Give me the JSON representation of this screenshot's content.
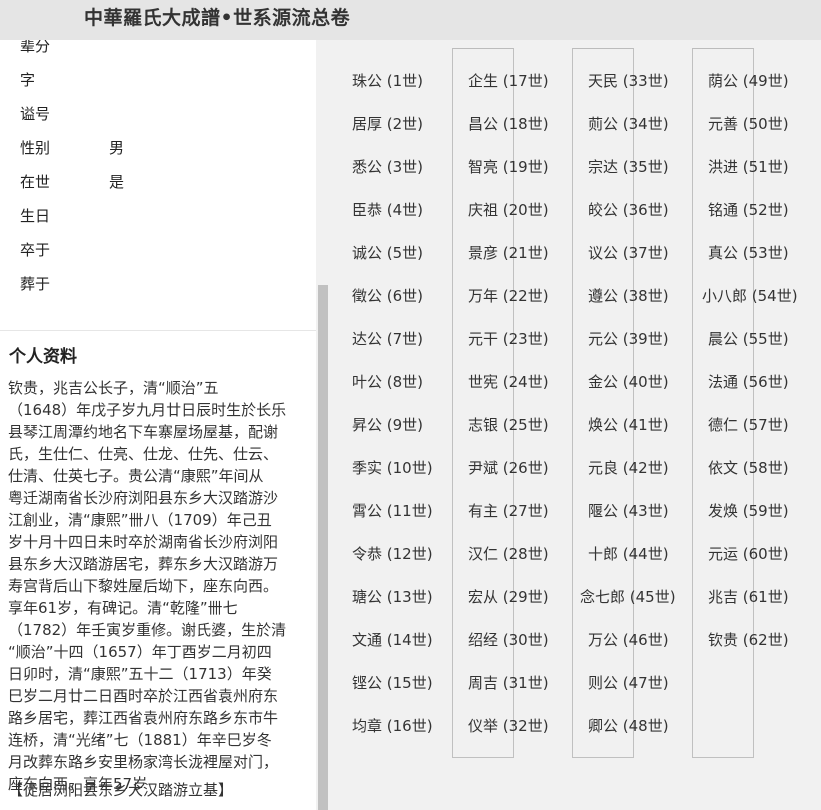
{
  "header": {
    "title": "中華羅氏大成譜•世系源流总卷"
  },
  "profile": {
    "fields": [
      {
        "label": "辈分",
        "value": ""
      },
      {
        "label": "字",
        "value": ""
      },
      {
        "label": "谥号",
        "value": ""
      },
      {
        "label": "性别",
        "value": "男"
      },
      {
        "label": "在世",
        "value": "是"
      },
      {
        "label": "生日",
        "value": ""
      },
      {
        "label": "卒于",
        "value": ""
      },
      {
        "label": "葬于",
        "value": ""
      }
    ],
    "bio_title": "个人资料",
    "bio_lines": [
      "钦贵，兆吉公长子，清“顺治”五",
      "（1648）年戊子岁九月廿日辰时生於长乐",
      "县琴江周潭约地名下车寨屋场屋基，配谢",
      "氏，生仕仁、仕亮、仕龙、仕先、仕云、",
      "仕清、仕英七子。贵公清“康熙”年间从",
      "粤迁湖南省长沙府浏阳县东乡大汉踏游沙",
      "江創业，清“康熙”卌八（1709）年己丑",
      "岁十月十四日未时卒於湖南省长沙府浏阳",
      "县东乡大汉踏游居宅，葬东乡大汉踏游万",
      "寿宫背后山下黎姓屋后坳下，座东向西。",
      "享年61岁，有碑记。清“乾隆”卌七",
      "（1782）年壬寅岁重修。谢氏婆，生於清",
      "“顺治”十四（1657）年丁酉岁二月初四",
      "日卯时，清“康熙”五十二（1713）年癸",
      "巳岁二月廿二日酉时卒於江西省袁州府东",
      "路乡居宅，葬江西省袁州府东路乡东市牛",
      "连桥，清“光绪”七（1881）年辛巳岁冬",
      "月改葬东路乡安里杨家湾长泷裡屋对门，",
      "座东向西。享年57岁"
    ],
    "bio_note": "【徙居浏阳县东乡大汉踏游立基】"
  },
  "lineage": {
    "columns": [
      [
        "珠公 (1世)",
        "居厚 (2世)",
        "悉公 (3世)",
        "臣恭 (4世)",
        "诚公 (5世)",
        "徵公 (6世)",
        "达公 (7世)",
        "叶公 (8世)",
        "昇公 (9世)",
        "季实 (10世)",
        "霄公 (11世)",
        "令恭 (12世)",
        "瑭公 (13世)",
        "文通 (14世)",
        "铿公 (15世)",
        "均章 (16世)"
      ],
      [
        "企生 (17世)",
        "昌公 (18世)",
        "智亮 (19世)",
        "庆祖 (20世)",
        "景彦 (21世)",
        "万年 (22世)",
        "元干 (23世)",
        "世宪 (24世)",
        "志银 (25世)",
        "尹斌 (26世)",
        "有主 (27世)",
        "汉仁 (28世)",
        "宏从 (29世)",
        "绍经 (30世)",
        "周吉 (31世)",
        "仪举 (32世)"
      ],
      [
        "天民 (33世)",
        "荝公 (34世)",
        "宗达 (35世)",
        "皎公 (36世)",
        "议公 (37世)",
        "遵公 (38世)",
        "元公 (39世)",
        "金公 (40世)",
        "焕公 (41世)",
        "元良 (42世)",
        "隁公 (43世)",
        "十郎 (44世)",
        "念七郎 (45世)",
        "万公 (46世)",
        "则公 (47世)",
        "卿公 (48世)"
      ],
      [
        "荫公 (49世)",
        "元善 (50世)",
        "洪进 (51世)",
        "铭通 (52世)",
        "真公 (53世)",
        "小八郎 (54世)",
        "晨公 (55世)",
        "法通 (56世)",
        "德仁 (57世)",
        "依文 (58世)",
        "发焕 (59世)",
        "元运 (60世)",
        "兆吉 (61世)",
        "钦贵 (62世)"
      ]
    ]
  }
}
